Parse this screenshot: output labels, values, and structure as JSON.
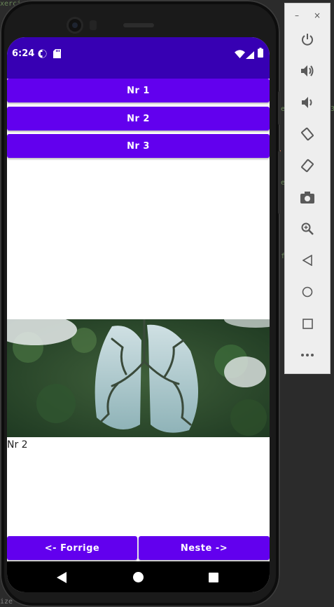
{
  "ide": {
    "top_fragment": "xerci",
    "bottom_fragment": "ize",
    "gutter_marks": [
      "e",
      "e",
      "f",
      "3"
    ]
  },
  "status_bar": {
    "time": "6:24",
    "background": "#3700b3"
  },
  "app": {
    "accent": "#6200ee",
    "buttons": [
      "Nr 1",
      "Nr 2",
      "Nr 3"
    ],
    "image_caption": "Nr 2",
    "prev_label": "<- Forrige",
    "next_label": "Neste ->"
  },
  "emulator": {
    "window_controls": {
      "minimize": "–",
      "close": "×"
    },
    "tools": [
      "power-icon",
      "volume-up-icon",
      "volume-down-icon",
      "rotate-left-icon",
      "rotate-right-icon",
      "camera-icon",
      "zoom-icon",
      "back-icon",
      "home-icon",
      "overview-icon",
      "more-icon"
    ]
  }
}
